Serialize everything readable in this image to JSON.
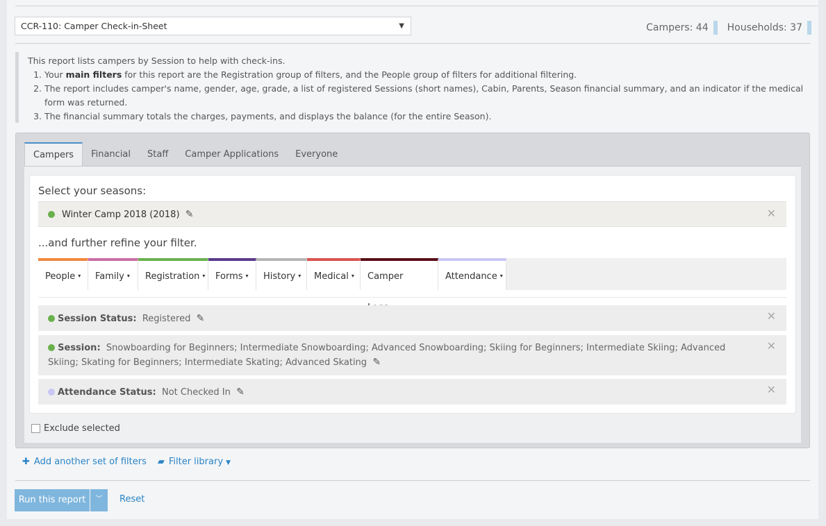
{
  "report": {
    "selected": "CCR-110: Camper Check-in-Sheet"
  },
  "counts": [
    {
      "label": "Campers: 44"
    },
    {
      "label": "Households: 37"
    }
  ],
  "description": {
    "intro": "This report lists campers by Session to help with check-ins.",
    "item1_pre": "Your ",
    "item1_bold": "main filters",
    "item1_post": " for this report are the Registration group of filters, and the People group of filters for additional filtering.",
    "item2": "The report includes camper's name, gender, age, grade, a list of registered Sessions (short names), Cabin, Parents, Season financial summary, and an indicator if the medical form was returned.",
    "item3": "The financial summary totals the charges, payments, and displays the balance (for the entire Season)."
  },
  "tabs": [
    "Campers",
    "Financial",
    "Staff",
    "Camper Applications",
    "Everyone"
  ],
  "seasons": {
    "heading": "Select your seasons:",
    "selected": "Winter Camp 2018 (2018)"
  },
  "refine_heading": "...and further refine your filter.",
  "categories": [
    {
      "label": "People",
      "color": "#f0883e"
    },
    {
      "label": "Family",
      "color": "#c86ea7"
    },
    {
      "label": "Registration",
      "color": "#6ab04c"
    },
    {
      "label": "Forms",
      "color": "#5b3a8c"
    },
    {
      "label": "History",
      "color": "#b5b5b5"
    },
    {
      "label": "Medical",
      "color": "#d9534f"
    },
    {
      "label": "Camper Logs",
      "color": "#5a0f17"
    },
    {
      "label": "Attendance",
      "color": "#c8c8f5"
    }
  ],
  "filters": {
    "session_status": {
      "label": "Session Status:",
      "value": "Registered",
      "color": "#6ab04c"
    },
    "session": {
      "label": "Session:",
      "value": "Snowboarding for Beginners; Intermediate Snowboarding; Advanced Snowboarding; Skiing for Beginners; Intermediate Skiing; Advanced Skiing; Skating for Beginners; Intermediate Skating; Advanced Skating",
      "color": "#6ab04c"
    },
    "attendance_status": {
      "label": "Attendance Status:",
      "value": "Not Checked In",
      "color": "#c8c8f5"
    }
  },
  "exclude_label": "Exclude selected",
  "actions": {
    "add_filters": "Add another set of filters",
    "filter_library": "Filter library",
    "run": "Run this report",
    "reset": "Reset"
  }
}
